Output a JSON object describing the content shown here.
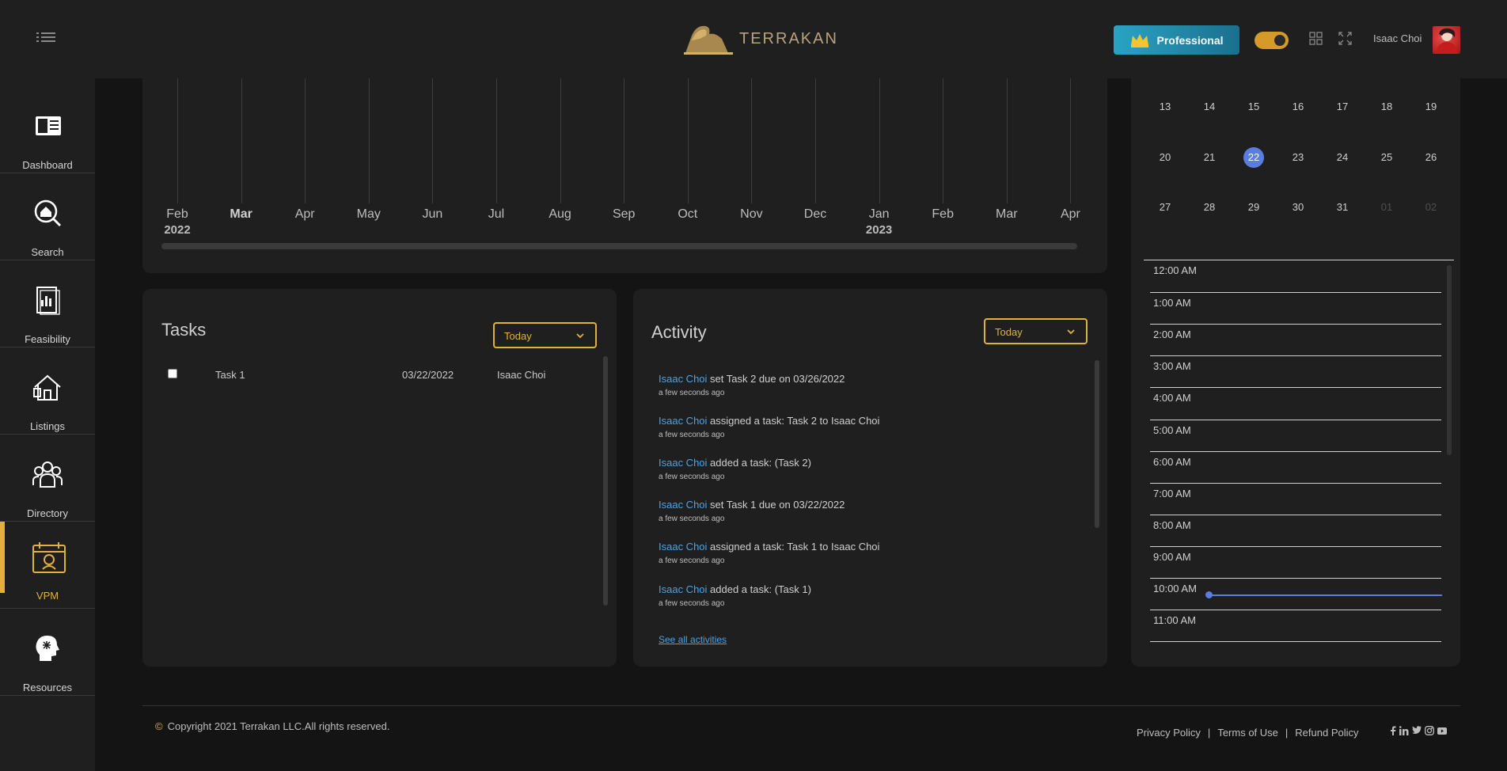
{
  "header": {
    "logo_text": "TERRAKAN",
    "plan_label": "Professional",
    "user_name": "Isaac Choi"
  },
  "sidebar": {
    "items": [
      {
        "label": "Dashboard",
        "icon": "dashboard-icon"
      },
      {
        "label": "Search",
        "icon": "search-home-icon"
      },
      {
        "label": "Feasibility",
        "icon": "feasibility-report-icon"
      },
      {
        "label": "Listings",
        "icon": "listings-house-icon"
      },
      {
        "label": "Directory",
        "icon": "directory-people-icon"
      },
      {
        "label": "VPM",
        "icon": "vpm-calendar-icon",
        "active": true
      },
      {
        "label": "Resources",
        "icon": "resources-head-icon"
      }
    ]
  },
  "timeline": {
    "months": [
      {
        "label": "Feb",
        "year": "2022"
      },
      {
        "label": "Mar",
        "bold": true
      },
      {
        "label": "Apr"
      },
      {
        "label": "May"
      },
      {
        "label": "Jun"
      },
      {
        "label": "Jul"
      },
      {
        "label": "Aug"
      },
      {
        "label": "Sep"
      },
      {
        "label": "Oct"
      },
      {
        "label": "Nov"
      },
      {
        "label": "Dec"
      },
      {
        "label": "Jan",
        "year": "2023"
      },
      {
        "label": "Feb"
      },
      {
        "label": "Mar"
      },
      {
        "label": "Apr"
      }
    ]
  },
  "tasks": {
    "title": "Tasks",
    "filter": "Today",
    "rows": [
      {
        "name": "Task 1",
        "date": "03/22/2022",
        "assignee": "Isaac Choi",
        "checked": false
      }
    ]
  },
  "activity": {
    "title": "Activity",
    "filter": "Today",
    "items": [
      {
        "who": "Isaac Choi",
        "text": " set Task 2 due on 03/26/2022",
        "when": "a few seconds ago"
      },
      {
        "who": "Isaac Choi",
        "text": " assigned a task: Task 2 to Isaac Choi",
        "when": "a few seconds ago"
      },
      {
        "who": "Isaac Choi",
        "text": " added a task: (Task 2)",
        "when": "a few seconds ago"
      },
      {
        "who": "Isaac Choi",
        "text": " set Task 1 due on 03/22/2022",
        "when": "a few seconds ago"
      },
      {
        "who": "Isaac Choi",
        "text": " assigned a task: Task 1 to Isaac Choi",
        "when": "a few seconds ago"
      },
      {
        "who": "Isaac Choi",
        "text": " added a task: (Task 1)",
        "when": "a few seconds ago"
      }
    ],
    "see_all": "See all activities"
  },
  "calendar": {
    "weeks": [
      [
        "13",
        "14",
        "15",
        "16",
        "17",
        "18",
        "19"
      ],
      [
        "20",
        "21",
        "22",
        "23",
        "24",
        "25",
        "26"
      ],
      [
        "27",
        "28",
        "29",
        "30",
        "31",
        "01",
        "02"
      ]
    ],
    "today": "22",
    "muted": [
      "01",
      "02"
    ],
    "hours": [
      "12:00 AM",
      "1:00 AM",
      "2:00 AM",
      "3:00 AM",
      "4:00 AM",
      "5:00 AM",
      "6:00 AM",
      "7:00 AM",
      "8:00 AM",
      "9:00 AM",
      "10:00 AM",
      "11:00 AM"
    ]
  },
  "footer": {
    "copyright": "Copyright 2021 Terrakan LLC.All rights reserved.",
    "links": [
      "Privacy Policy",
      "Terms of Use",
      "Refund Policy"
    ],
    "separator": "|",
    "socials": [
      "f",
      "in",
      "t",
      "ig",
      "yt"
    ]
  },
  "colors": {
    "accent": "#e0b23d",
    "link": "#4aa3e8",
    "today": "#5b7de0",
    "plan": "#2aa3c4"
  }
}
